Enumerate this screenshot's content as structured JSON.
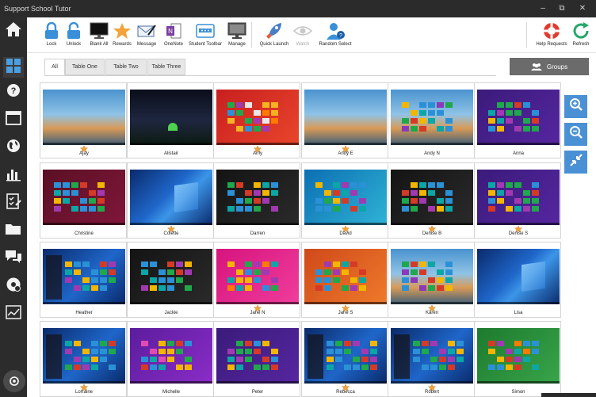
{
  "window": {
    "title": "Support School Tutor",
    "minimize": "–",
    "restore": "⧉",
    "close": "✕"
  },
  "colors": {
    "accent": "#4a90d4",
    "sidebar": "#2c2c2c",
    "titlebar": "#2b2b2b"
  },
  "toolbar": {
    "items": [
      {
        "id": "lock",
        "label": "Lock",
        "icon": "lock-icon"
      },
      {
        "id": "unlock",
        "label": "Unlock",
        "icon": "unlock-icon"
      },
      {
        "id": "blank-all",
        "label": "Blank All",
        "icon": "monitor-icon"
      },
      {
        "id": "rewards",
        "label": "Rewards",
        "icon": "star-icon"
      },
      {
        "id": "message",
        "label": "Message",
        "icon": "envelope-icon"
      },
      {
        "id": "onenote",
        "label": "OneNote",
        "icon": "onenote-icon"
      },
      {
        "id": "student-toolbar",
        "label": "Student Toolbar",
        "icon": "toolbar-icon"
      },
      {
        "id": "manage",
        "label": "Manage",
        "icon": "manage-monitor-icon"
      },
      {
        "id": "quick-launch",
        "label": "Quick Launch",
        "icon": "rocket-icon"
      },
      {
        "id": "watch",
        "label": "Watch",
        "icon": "eye-icon",
        "disabled": true
      },
      {
        "id": "random-select",
        "label": "Random Select",
        "icon": "random-user-icon"
      },
      {
        "id": "help-requests",
        "label": "Help Requests",
        "icon": "lifebuoy-icon"
      },
      {
        "id": "refresh",
        "label": "Refresh",
        "icon": "refresh-icon"
      }
    ]
  },
  "sidebar": {
    "items": [
      {
        "icon": "home-icon"
      },
      {
        "icon": "grid-icon",
        "active": true
      },
      {
        "icon": "help-bubble-icon"
      },
      {
        "icon": "window-icon"
      },
      {
        "icon": "globe-icon"
      },
      {
        "icon": "bar-chart-icon"
      },
      {
        "icon": "checklist-icon"
      },
      {
        "icon": "folder-icon"
      },
      {
        "icon": "chat-icon"
      },
      {
        "icon": "disc-icon"
      },
      {
        "icon": "line-chart-icon"
      }
    ]
  },
  "tabs": [
    {
      "label": "All",
      "active": true
    },
    {
      "label": "Table One"
    },
    {
      "label": "Table Two"
    },
    {
      "label": "Table Three"
    }
  ],
  "groups_button": {
    "label": "Groups",
    "icon": "group-icon"
  },
  "students": [
    {
      "name": "Ajay",
      "screen": "beach",
      "star": true
    },
    {
      "name": "Alistair",
      "screen": "night",
      "star": false
    },
    {
      "name": "Amy",
      "screen": "red-start",
      "star": true
    },
    {
      "name": "Andy E",
      "screen": "beach",
      "star": true
    },
    {
      "name": "Andy N",
      "screen": "beach-start",
      "star": false
    },
    {
      "name": "Anna",
      "screen": "purple-start",
      "star": false
    },
    {
      "name": "Christine",
      "screen": "maroon-start",
      "star": false
    },
    {
      "name": "Colette",
      "screen": "blue-desktop",
      "star": true
    },
    {
      "name": "Darren",
      "screen": "dark-start",
      "star": false
    },
    {
      "name": "David",
      "screen": "aqua-start",
      "star": true
    },
    {
      "name": "Denise B",
      "screen": "dark-start",
      "star": true
    },
    {
      "name": "Denise S",
      "screen": "purple-start",
      "star": true
    },
    {
      "name": "Heather",
      "screen": "win10-start",
      "star": false
    },
    {
      "name": "Jackie",
      "screen": "dark-start",
      "star": false
    },
    {
      "name": "Jane N",
      "screen": "pink-start",
      "star": true
    },
    {
      "name": "Jane S",
      "screen": "orange-start",
      "star": true
    },
    {
      "name": "Karen",
      "screen": "beach-start",
      "star": true
    },
    {
      "name": "Lisa",
      "screen": "blue-desktop",
      "star": false
    },
    {
      "name": "Lorraine",
      "screen": "win10-start",
      "star": true
    },
    {
      "name": "Michelle",
      "screen": "violet-start",
      "star": false
    },
    {
      "name": "Peter",
      "screen": "purple-start",
      "star": false
    },
    {
      "name": "Rebecca",
      "screen": "win10-start",
      "star": true
    },
    {
      "name": "Robert",
      "screen": "win10-start",
      "star": true
    },
    {
      "name": "Simon",
      "screen": "green-start",
      "star": false
    }
  ],
  "zoom": [
    {
      "icon": "zoom-in-icon"
    },
    {
      "icon": "zoom-out-icon"
    },
    {
      "icon": "shrink-icon"
    }
  ]
}
